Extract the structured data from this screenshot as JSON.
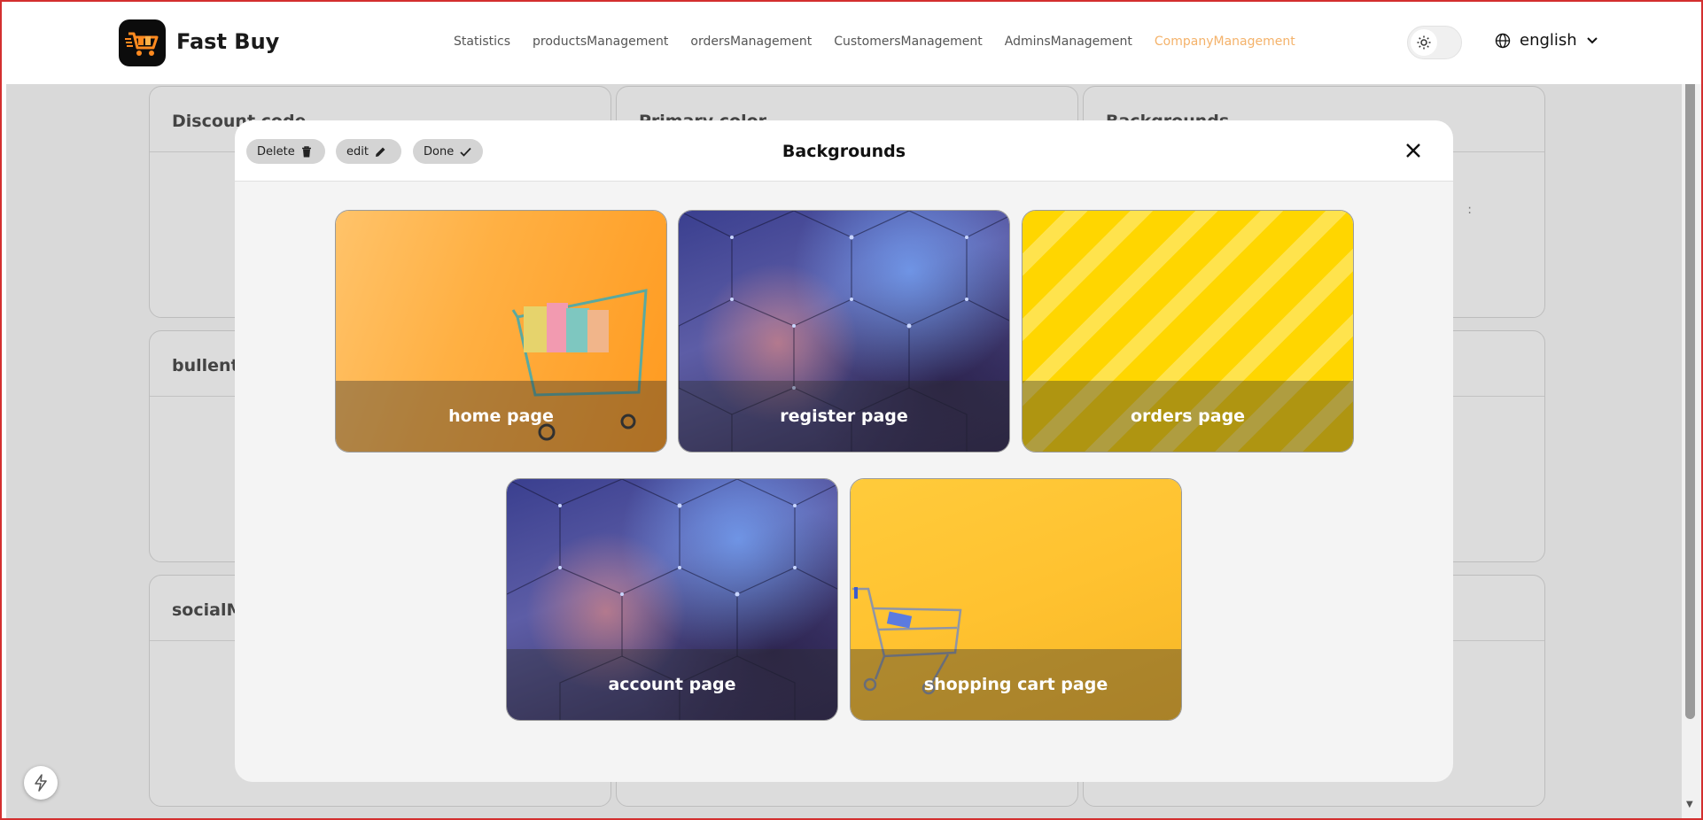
{
  "header": {
    "app_name": "Fast Buy",
    "nav": [
      {
        "label": "Statistics"
      },
      {
        "label": "productsManagement"
      },
      {
        "label": "ordersManagement"
      },
      {
        "label": "CustomersManagement"
      },
      {
        "label": "AdminsManagement"
      },
      {
        "label": "CompanyManagement",
        "active": true
      }
    ],
    "language": "english"
  },
  "background_cards": {
    "discount": "Discount code",
    "primary_color": "Primary color",
    "backgrounds": "Backgrounds",
    "bullentin": "bullenti",
    "social": "socialMe",
    "colon": ":"
  },
  "modal": {
    "title": "Backgrounds",
    "delete_label": "Delete",
    "edit_label": "edit",
    "done_label": "Done",
    "items": [
      {
        "label": "home page"
      },
      {
        "label": "register page"
      },
      {
        "label": "orders page"
      },
      {
        "label": "account page"
      },
      {
        "label": "shopping cart page"
      }
    ]
  },
  "colors": {
    "accent": "#f4b26a",
    "overlay": "#d9d9d9",
    "modal_bg": "#f4f4f4",
    "logo_orange": "#ff8a1f"
  },
  "icons": {
    "logo": "shopping-cart-icon",
    "theme": "sun-icon",
    "language": "globe-icon",
    "delete": "trash-icon",
    "edit": "pencil-icon",
    "done": "check-icon",
    "close": "close-icon",
    "quick": "bolt-icon"
  }
}
